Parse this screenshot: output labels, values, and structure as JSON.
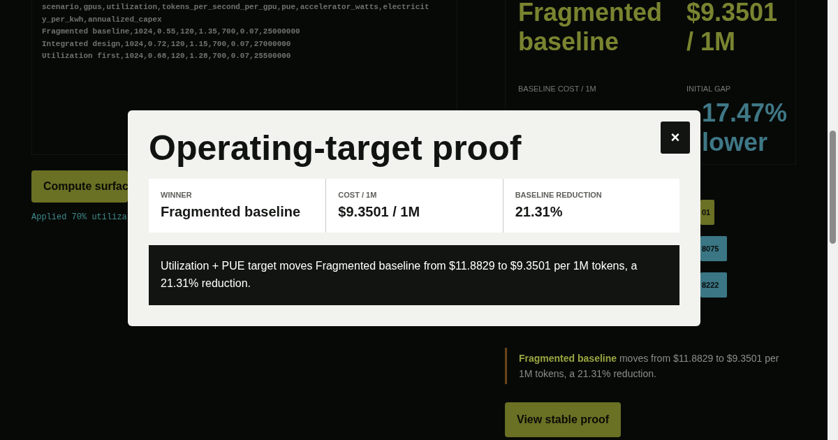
{
  "source": {
    "lines": [
      "scenario,gpus,utilization,tokens_per_second_per_gpu,pue,accelerator_watts,electricit",
      "y_per_kwh,annualized_capex",
      "Fragmented baseline,1024,0.55,120,1.35,700,0.07,25000000",
      "Integrated design,1024,0.72,120,1.15,700,0.07,27000000",
      "Utilization first,1024,0.68,120,1.28,700,0.07,25500000"
    ]
  },
  "compute_button": "Compute surfac",
  "status": "Applied 70% utiliza",
  "summary": {
    "winner": "Fragmented baseline",
    "cost": "$9.3501 / 1M",
    "baseline_label": "BASELINE COST / 1M",
    "gap_label": "INITIAL GAP",
    "gap": "17.47% lower"
  },
  "chips": [
    {
      "text": "01",
      "color": "#6a7024"
    },
    {
      "text": "8075",
      "color": "#3a7684"
    },
    {
      "text": "8222",
      "color": "#3a7684"
    }
  ],
  "quote": "**Fragmented baseline** moves from $11.8829 to $9.3501 per 1M tokens, a 21.31% reduction.",
  "stable_button": "View stable proof",
  "modal": {
    "title": "Operating-target proof",
    "close": "×",
    "stats": [
      {
        "label": "WINNER",
        "value": "Fragmented baseline"
      },
      {
        "label": "COST / 1M",
        "value": "$9.3501 / 1M"
      },
      {
        "label": "BASELINE REDUCTION",
        "value": "21.31%"
      }
    ],
    "note": "Utilization + PUE target moves Fragmented baseline from $11.8829 to $9.3501 per 1M tokens, a 21.31% reduction."
  }
}
